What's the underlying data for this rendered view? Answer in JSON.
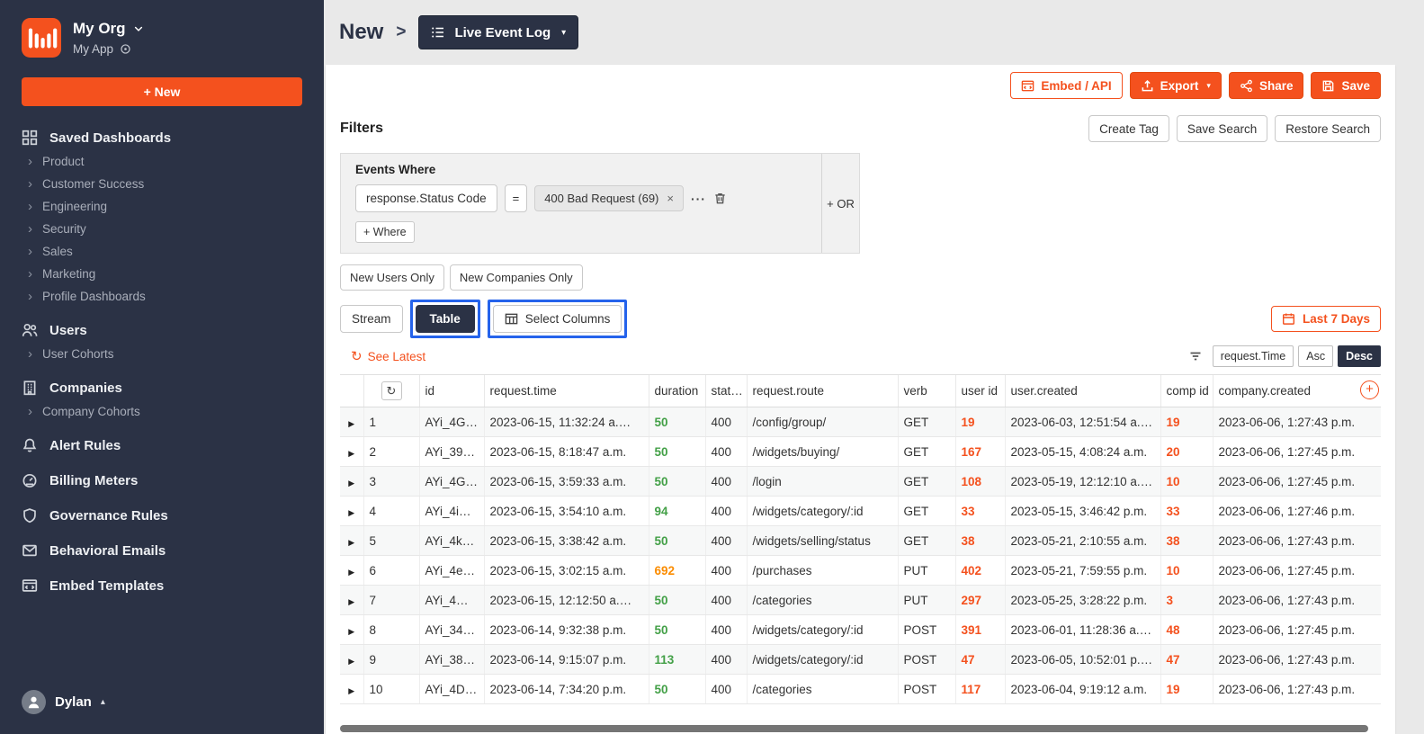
{
  "colors": {
    "brand_orange": "#f4511e",
    "navy": "#2b3245",
    "annotation_blue": "#2563eb",
    "duration_ok_green": "#43a047",
    "duration_warn_amber": "#fb8c00"
  },
  "annotations": {
    "color": "#2563eb",
    "highlighted": [
      "Table",
      "Select Columns"
    ]
  },
  "sidebar": {
    "org_name": "My Org",
    "app_name": "My App",
    "new_button": "+ New",
    "sections": [
      {
        "icon": "dashboards-icon",
        "label": "Saved Dashboards",
        "children": [
          "Product",
          "Customer Success",
          "Engineering",
          "Security",
          "Sales",
          "Marketing",
          "Profile Dashboards"
        ]
      },
      {
        "icon": "users-icon",
        "label": "Users",
        "children": [
          "User Cohorts"
        ]
      },
      {
        "icon": "companies-icon",
        "label": "Companies",
        "children": [
          "Company Cohorts"
        ]
      },
      {
        "icon": "bell-icon",
        "label": "Alert Rules",
        "children": []
      },
      {
        "icon": "meter-icon",
        "label": "Billing Meters",
        "children": []
      },
      {
        "icon": "shield-icon",
        "label": "Governance Rules",
        "children": []
      },
      {
        "icon": "email-icon",
        "label": "Behavioral Emails",
        "children": []
      },
      {
        "icon": "embed-icon",
        "label": "Embed Templates",
        "children": []
      }
    ],
    "user_name": "Dylan"
  },
  "header": {
    "title": "New",
    "separator": ">",
    "view_selector": "Live Event Log"
  },
  "toolbar": {
    "embed_api": "Embed / API",
    "export": "Export",
    "share": "Share",
    "save": "Save"
  },
  "filters": {
    "title": "Filters",
    "actions": [
      "Create Tag",
      "Save Search",
      "Restore Search"
    ],
    "group_label": "Events Where",
    "field": "response.Status Code",
    "operator": "=",
    "value_tag": "400 Bad Request (69)",
    "remove_tag": "×",
    "more": "···",
    "add_where": "+ Where",
    "add_or": "+ OR",
    "quick_filters": [
      "New Users Only",
      "New Companies Only"
    ]
  },
  "view_tabs": {
    "stream": "Stream",
    "table": "Table",
    "select_columns": "Select Columns",
    "date_range": "Last 7 Days"
  },
  "table_controls": {
    "see_latest": "See Latest",
    "sort_field": "request.Time",
    "asc": "Asc",
    "desc": "Desc"
  },
  "table": {
    "columns": [
      "id",
      "request.time",
      "duration",
      "stat…",
      "request.route",
      "verb",
      "user id",
      "user.created",
      "comp id",
      "company.created"
    ],
    "rows": [
      {
        "num": "1",
        "id": "AYi_4G…",
        "request_time": "2023-06-15, 11:32:24 a.…",
        "duration": "50",
        "duration_level": "ok",
        "status": "400",
        "route": "/config/group/",
        "verb": "GET",
        "user_id": "19",
        "user_created": "2023-06-03, 12:51:54 a.…",
        "comp_id": "19",
        "company_created": "2023-06-06, 1:27:43 p.m."
      },
      {
        "num": "2",
        "id": "AYi_39…",
        "request_time": "2023-06-15, 8:18:47 a.m.",
        "duration": "50",
        "duration_level": "ok",
        "status": "400",
        "route": "/widgets/buying/",
        "verb": "GET",
        "user_id": "167",
        "user_created": "2023-05-15, 4:08:24 a.m.",
        "comp_id": "20",
        "company_created": "2023-06-06, 1:27:45 p.m."
      },
      {
        "num": "3",
        "id": "AYi_4G…",
        "request_time": "2023-06-15, 3:59:33 a.m.",
        "duration": "50",
        "duration_level": "ok",
        "status": "400",
        "route": "/login",
        "verb": "GET",
        "user_id": "108",
        "user_created": "2023-05-19, 12:12:10 a.…",
        "comp_id": "10",
        "company_created": "2023-06-06, 1:27:45 p.m."
      },
      {
        "num": "4",
        "id": "AYi_4i…",
        "request_time": "2023-06-15, 3:54:10 a.m.",
        "duration": "94",
        "duration_level": "ok",
        "status": "400",
        "route": "/widgets/category/:id",
        "verb": "GET",
        "user_id": "33",
        "user_created": "2023-05-15, 3:46:42 p.m.",
        "comp_id": "33",
        "company_created": "2023-06-06, 1:27:46 p.m."
      },
      {
        "num": "5",
        "id": "AYi_4k…",
        "request_time": "2023-06-15, 3:38:42 a.m.",
        "duration": "50",
        "duration_level": "ok",
        "status": "400",
        "route": "/widgets/selling/status",
        "verb": "GET",
        "user_id": "38",
        "user_created": "2023-05-21, 2:10:55 a.m.",
        "comp_id": "38",
        "company_created": "2023-06-06, 1:27:43 p.m."
      },
      {
        "num": "6",
        "id": "AYi_4e…",
        "request_time": "2023-06-15, 3:02:15 a.m.",
        "duration": "692",
        "duration_level": "warn",
        "status": "400",
        "route": "/purchases",
        "verb": "PUT",
        "user_id": "402",
        "user_created": "2023-05-21, 7:59:55 p.m.",
        "comp_id": "10",
        "company_created": "2023-06-06, 1:27:45 p.m."
      },
      {
        "num": "7",
        "id": "AYi_4…",
        "request_time": "2023-06-15, 12:12:50 a.…",
        "duration": "50",
        "duration_level": "ok",
        "status": "400",
        "route": "/categories",
        "verb": "PUT",
        "user_id": "297",
        "user_created": "2023-05-25, 3:28:22 p.m.",
        "comp_id": "3",
        "company_created": "2023-06-06, 1:27:43 p.m."
      },
      {
        "num": "8",
        "id": "AYi_34…",
        "request_time": "2023-06-14, 9:32:38 p.m.",
        "duration": "50",
        "duration_level": "ok",
        "status": "400",
        "route": "/widgets/category/:id",
        "verb": "POST",
        "user_id": "391",
        "user_created": "2023-06-01, 11:28:36 a.…",
        "comp_id": "48",
        "company_created": "2023-06-06, 1:27:45 p.m."
      },
      {
        "num": "9",
        "id": "AYi_38…",
        "request_time": "2023-06-14, 9:15:07 p.m.",
        "duration": "113",
        "duration_level": "ok",
        "status": "400",
        "route": "/widgets/category/:id",
        "verb": "POST",
        "user_id": "47",
        "user_created": "2023-06-05, 10:52:01 p.…",
        "comp_id": "47",
        "company_created": "2023-06-06, 1:27:43 p.m."
      },
      {
        "num": "10",
        "id": "AYi_4D…",
        "request_time": "2023-06-14, 7:34:20 p.m.",
        "duration": "50",
        "duration_level": "ok",
        "status": "400",
        "route": "/categories",
        "verb": "POST",
        "user_id": "117",
        "user_created": "2023-06-04, 9:19:12 a.m.",
        "comp_id": "19",
        "company_created": "2023-06-06, 1:27:43 p.m."
      }
    ]
  }
}
